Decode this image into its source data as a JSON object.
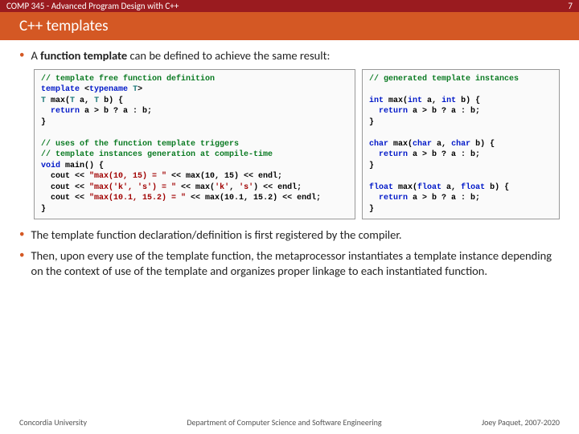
{
  "header": {
    "course": "COMP 345 - Advanced Program Design with C++",
    "page_num": "7",
    "title": "C++ templates"
  },
  "bullets": {
    "b1_prefix": "A ",
    "b1_bold": "function template",
    "b1_suffix": " can be defined to achieve the same result:",
    "b2": "The template function declaration/definition is first registered by the compiler.",
    "b3": "Then, upon every use of the template function, the metaprocessor instantiates a template instance depending on the context of use of the template and organizes proper linkage to each instantiated function."
  },
  "code_left": {
    "c1": "// template free function definition",
    "l1a": "template",
    "l1b": " <",
    "l1c": "typename",
    "l1d": " ",
    "l1e": "T",
    "l1f": ">",
    "l2a": "T",
    "l2b": " max(",
    "l2c": "T",
    "l2d": " a, ",
    "l2e": "T",
    "l2f": " b) {",
    "l3a": "  return",
    "l3b": " a > b ? a : b;",
    "l4": "}",
    "blank1": "",
    "c2": "// uses of the function template triggers",
    "c3": "// template instances generation at compile-time",
    "l5a": "void",
    "l5b": " main() {",
    "l6a": "  cout << ",
    "l6b": "\"max(10, 15) = \"",
    "l6c": " << max(10, 15) << endl;",
    "l7a": "  cout << ",
    "l7b": "\"max('k', 's') = \"",
    "l7c": " << max(",
    "l7d": "'k'",
    "l7e": ", ",
    "l7f": "'s'",
    "l7g": ") << endl;",
    "l8a": "  cout << ",
    "l8b": "\"max(10.1, 15.2) = \"",
    "l8c": " << max(10.1, 15.2) << endl;",
    "l9": "}"
  },
  "code_right": {
    "c1": "// generated template instances",
    "blank1": "",
    "l1a": "int",
    "l1b": " max(",
    "l1c": "int",
    "l1d": " a, ",
    "l1e": "int",
    "l1f": " b) {",
    "l2a": "  return",
    "l2b": " a > b ? a : b;",
    "l3": "}",
    "blank2": "",
    "l4a": "char",
    "l4b": " max(",
    "l4c": "char",
    "l4d": " a, ",
    "l4e": "char",
    "l4f": " b) {",
    "l5a": "  return",
    "l5b": " a > b ? a : b;",
    "l6": "}",
    "blank3": "",
    "l7a": "float",
    "l7b": " max(",
    "l7c": "float",
    "l7d": " a, ",
    "l7e": "float",
    "l7f": " b) {",
    "l8a": "  return",
    "l8b": " a > b ? a : b;",
    "l9": "}"
  },
  "footer": {
    "left": "Concordia University",
    "center": "Department of Computer Science and Software Engineering",
    "right": "Joey Paquet, 2007-2020"
  }
}
